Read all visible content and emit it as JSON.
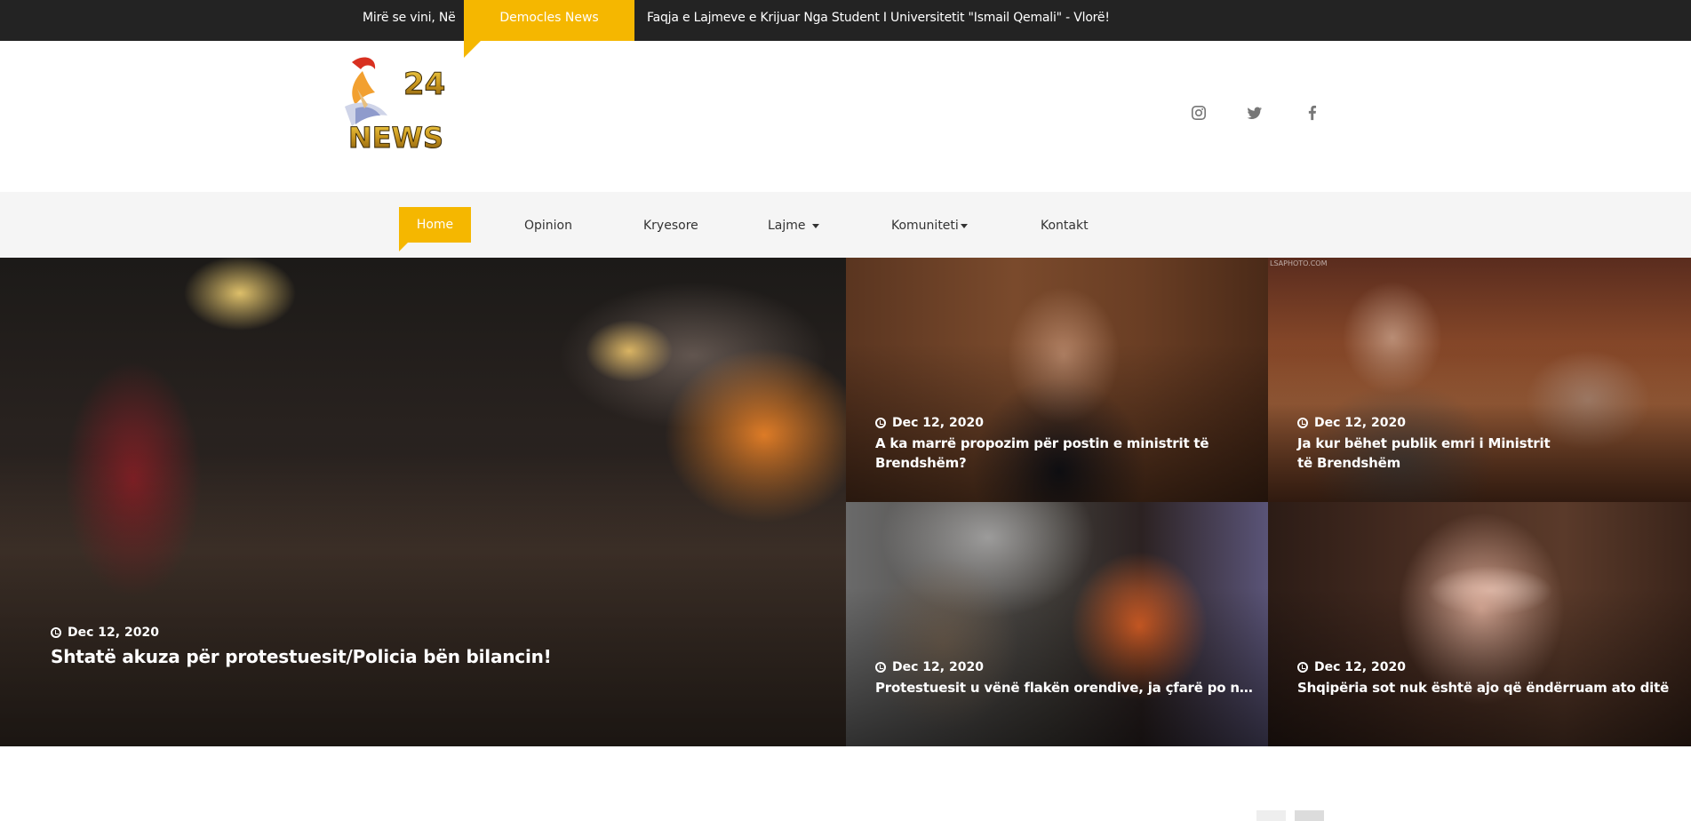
{
  "topbar": {
    "welcome": "Mirë se vini, Në",
    "brand": "Democles News",
    "tagline": "Faqja e Lajmeve e Krijuar Nga Student I Universitetit \"Ismail Qemali\" - Vlorë!"
  },
  "logo": {
    "top_text": "24",
    "bottom_text": "NEWS"
  },
  "social": [
    "instagram-icon",
    "twitter-icon",
    "facebook-icon"
  ],
  "nav": {
    "home": "Home",
    "opinion": "Opinion",
    "kryesore": "Kryesore",
    "lajme": "Lajme",
    "komuniteti": "Komuniteti",
    "kontakt": "Kontakt"
  },
  "colors": {
    "accent": "#f5b700",
    "topbar": "#232323",
    "navbar": "#f5f5f5"
  },
  "featured": {
    "main": {
      "date": "Dec 12, 2020",
      "title": "Shtatë akuza për protestuesit/Policia bën bilancin!"
    },
    "a": {
      "date": "Dec 12, 2020",
      "title": "A ka marrë propozim për postin e ministrit të Brendshëm?"
    },
    "b": {
      "date": "Dec 12, 2020",
      "title": "Ja kur bëhet publik emri i Ministrit të Brendshëm",
      "stamp": "LSAPHOTO.COM"
    },
    "c": {
      "date": "Dec 12, 2020",
      "title": "Protestuesit u vënë flakën orendive, ja çfarë po ndodh..."
    },
    "d": {
      "date": "Dec 12, 2020",
      "title": "Shqipëria sot nuk është ajo që ëndërruam ato ditë"
    }
  }
}
